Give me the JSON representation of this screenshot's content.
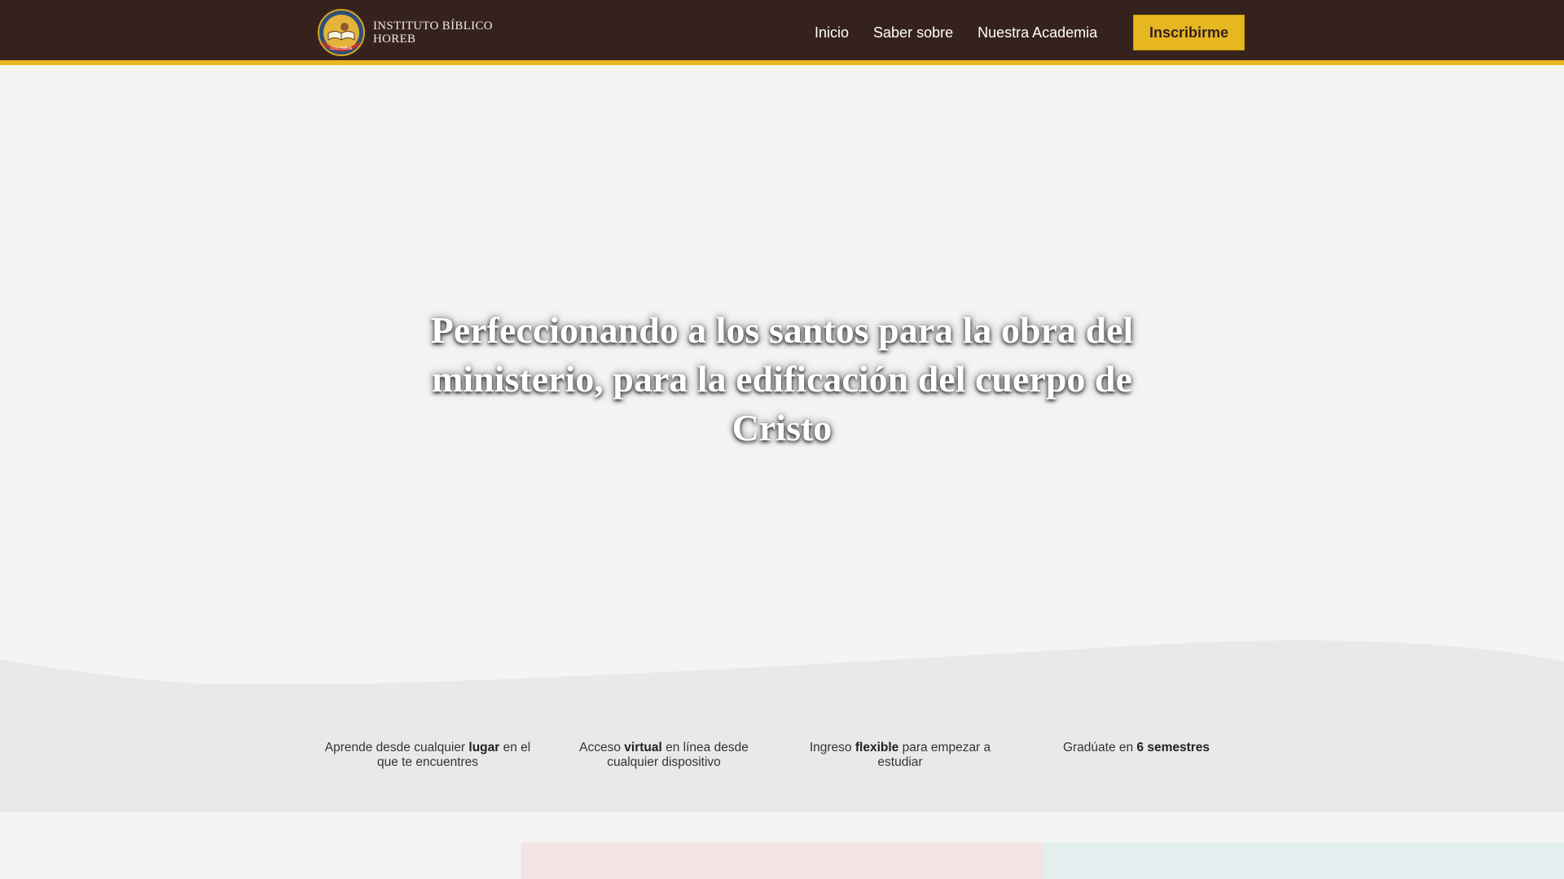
{
  "header": {
    "logo_line1": "INSTITUTO BÍBLICO",
    "logo_line2": "HOREB",
    "seal_text": "COLOMBIA",
    "nav": [
      {
        "label": "Inicio"
      },
      {
        "label": "Saber sobre"
      },
      {
        "label": "Nuestra Academia"
      }
    ],
    "cta_label": "Inscribirme"
  },
  "hero": {
    "title": "Perfeccionando a los santos para la obra del ministerio, para la edificación del cuerpo de Cristo"
  },
  "features": [
    {
      "pre": "Aprende desde cualquier ",
      "bold": "lugar",
      "post": " en el que te encuentres"
    },
    {
      "pre": "Acceso ",
      "bold": "virtual",
      "post": " en línea desde cualquier dispositivo"
    },
    {
      "pre": "Ingreso ",
      "bold": "flexible",
      "post": " para empezar a estudiar"
    },
    {
      "pre": "Gradúate en ",
      "bold": "6 semestres",
      "post": ""
    }
  ],
  "colors": {
    "header_bg": "#36221d",
    "accent": "#e7b722",
    "page_bg": "#f4f4f3",
    "features_bg": "#e9e9ea"
  }
}
